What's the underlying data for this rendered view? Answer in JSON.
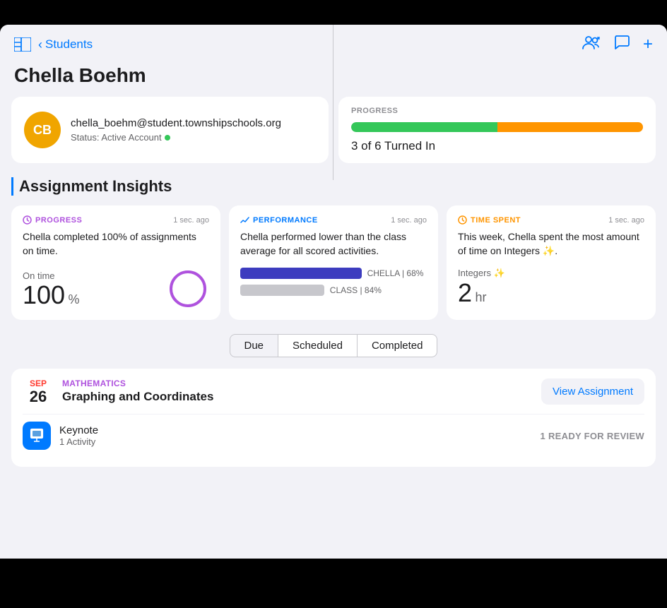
{
  "header": {
    "back_label": "Students",
    "page_title": "Chella Boehm"
  },
  "profile": {
    "initials": "CB",
    "email": "chella_boehm@student.townshipschools.org",
    "status_label": "Status: Active Account"
  },
  "progress_card": {
    "label": "PROGRESS",
    "green_pct": 50,
    "orange_pct": 50,
    "text": "3 of 6 Turned In"
  },
  "insights": {
    "section_title": "Assignment Insights",
    "cards": [
      {
        "type": "PROGRESS",
        "timestamp": "1 sec. ago",
        "description": "Chella completed 100% of assignments on time.",
        "metric_label": "On time",
        "metric_value": "100",
        "metric_unit": "%"
      },
      {
        "type": "PERFORMANCE",
        "timestamp": "1 sec. ago",
        "description": "Chella performed lower than the class average for all scored activities.",
        "chella_label": "CHELLA | 68%",
        "class_label": "CLASS | 84%"
      },
      {
        "type": "TIME SPENT",
        "timestamp": "1 sec. ago",
        "description": "This week, Chella spent the most amount of time on Integers ✨.",
        "topic_label": "Integers ✨",
        "time_value": "2",
        "time_unit": "hr"
      }
    ]
  },
  "filter_tabs": {
    "tabs": [
      "Due",
      "Scheduled",
      "Completed"
    ],
    "active": "Due"
  },
  "assignment": {
    "month": "SEP",
    "day": "26",
    "subject": "MATHEMATICS",
    "title": "Graphing and Coordinates",
    "view_btn": "View Assignment",
    "activity": {
      "icon_label": "keynote-icon",
      "name": "Keynote",
      "count": "1 Activity",
      "status": "1 READY FOR REVIEW"
    }
  },
  "icons": {
    "sidebar": "⊞",
    "add_person": "👤",
    "chat": "💬",
    "plus": "+"
  }
}
